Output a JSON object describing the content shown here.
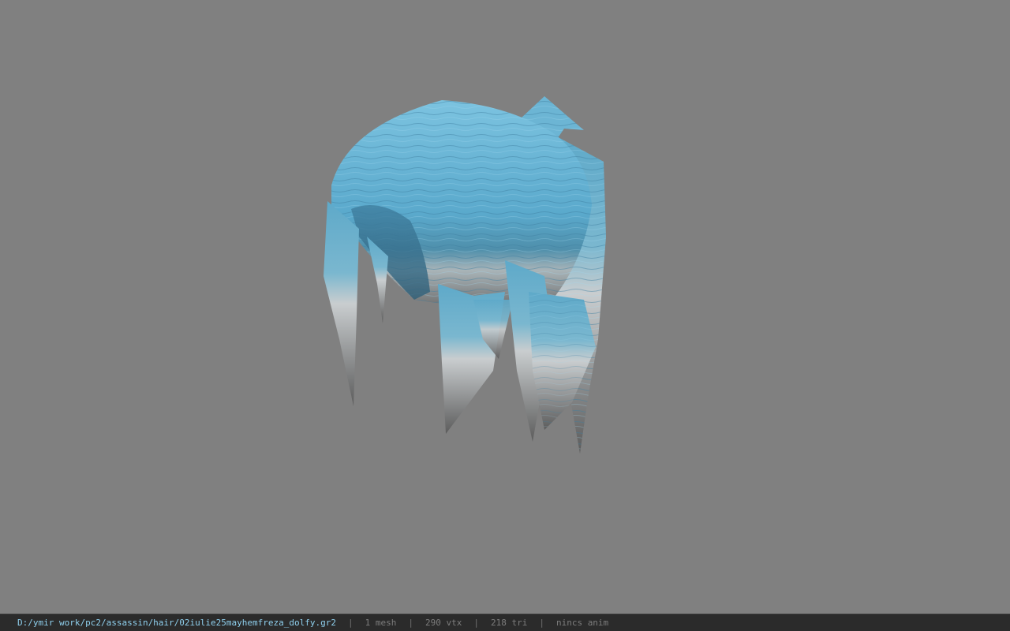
{
  "viewer": {
    "background_color": "#808080",
    "model": {
      "name": "hair mesh",
      "hair_color": "#6fb8d8",
      "tip_color": "#c8c8c8"
    }
  },
  "status_bar": {
    "file_path": "D:/ymir work/pc2/assassin/hair/02iulie25mayhemfreza_dolfy.gr2",
    "separator": "|",
    "mesh_count": "1 mesh",
    "vertex_count": "290 vtx",
    "triangle_count": "218 tri",
    "animation": "nincs anim"
  }
}
